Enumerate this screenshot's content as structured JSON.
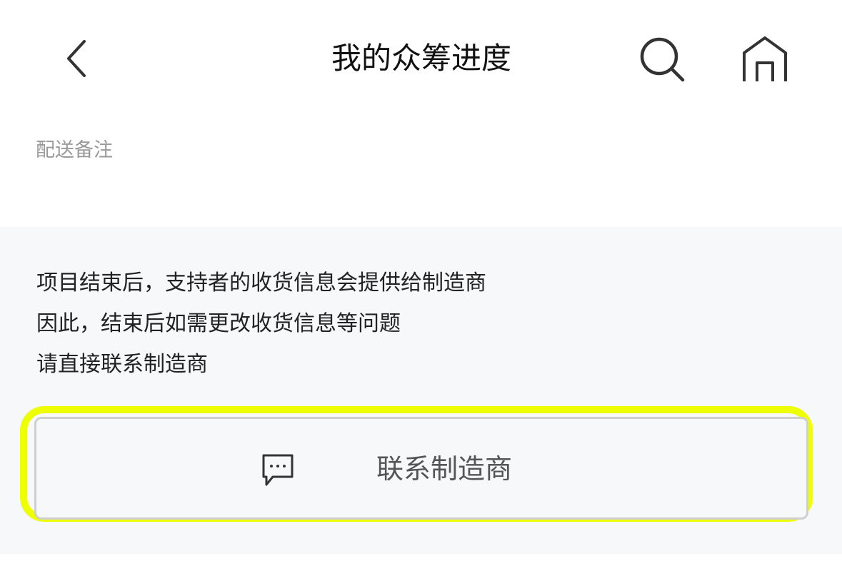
{
  "header": {
    "title": "我的众筹进度",
    "back_icon": "chevron-left-icon",
    "search_icon": "search-icon",
    "home_icon": "home-icon"
  },
  "delivery": {
    "note_label": "配送备注"
  },
  "info": {
    "lines": [
      "项目结束后，支持者的收货信息会提供给制造商",
      "因此，结束后如需更改收货信息等问题",
      "请直接联系制造商"
    ]
  },
  "contact": {
    "label": "联系制造商",
    "icon": "chat-bubble-icon"
  },
  "colors": {
    "highlight": "#eeff00",
    "panel_bg": "#f7f8fa",
    "icon": "#333333"
  }
}
